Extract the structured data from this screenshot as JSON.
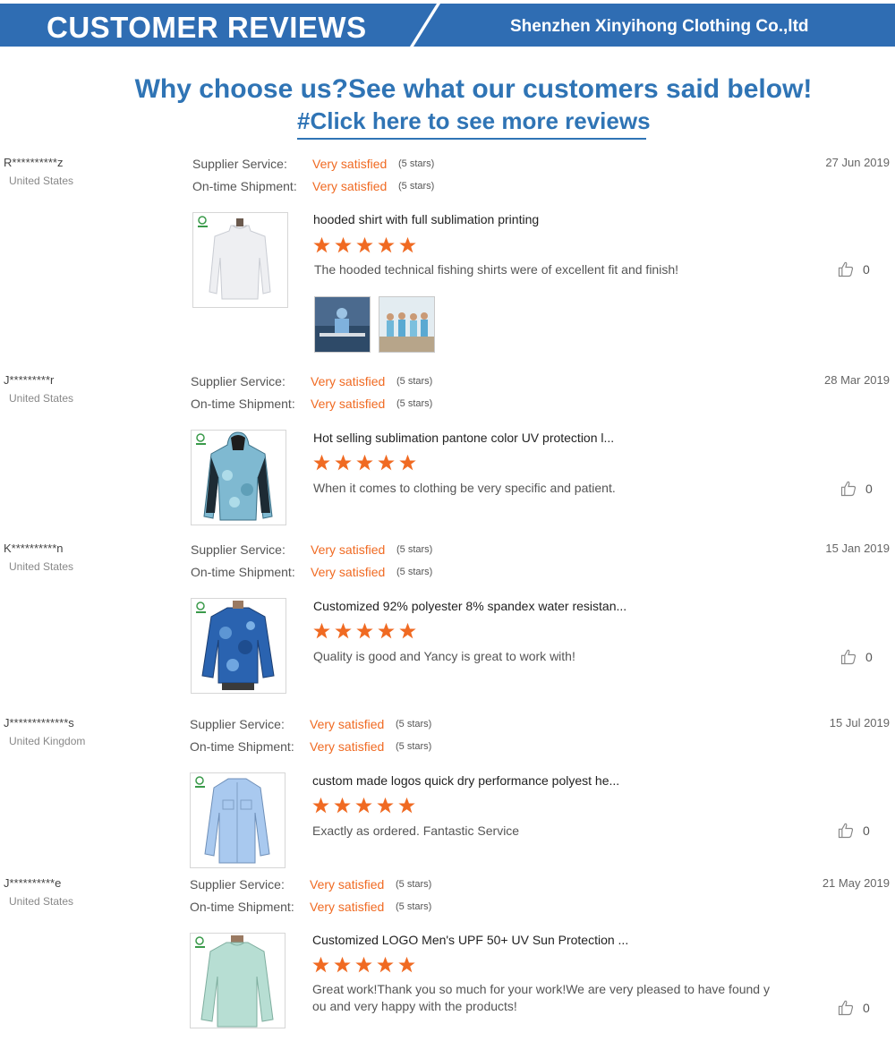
{
  "banner": {
    "title": "CUSTOMER REVIEWS",
    "company": "Shenzhen Xinyihong Clothing Co.,ltd",
    "bg_color": "#2f6db3",
    "accent_color": "#ffffff"
  },
  "intro": {
    "headline": "Why choose us?See what our customers said below!",
    "more_link": "#Click here to see more reviews"
  },
  "labels": {
    "supplier_service": "Supplier Service:",
    "on_time_shipment": "On-time Shipment:"
  },
  "colors": {
    "accent": "#f06a22",
    "headline": "#2f74b5"
  },
  "reviews": [
    {
      "user": "R**********z",
      "country": "United States",
      "date": "27 Jun 2019",
      "supplier_rating": "Very satisfied",
      "supplier_stars": "(5 stars)",
      "shipment_rating": "Very satisfied",
      "shipment_stars": "(5 stars)",
      "product_title": "hooded shirt with full sublimation printing",
      "product_image": "white-long-sleeve-shirt",
      "rating": 5,
      "comment": "The hooded technical fishing shirts were of excellent fit and finish!",
      "likes": "0",
      "photos": [
        "customer-photo-boat",
        "customer-photo-group"
      ]
    },
    {
      "user": "J*********r",
      "country": "United States",
      "date": "28 Mar 2019",
      "supplier_rating": "Very satisfied",
      "supplier_stars": "(5 stars)",
      "shipment_rating": "Very satisfied",
      "shipment_stars": "(5 stars)",
      "product_title": "Hot selling sublimation pantone color UV protection l...",
      "product_image": "camo-hooded-shirt",
      "rating": 5,
      "comment": "When it comes to clothing be very specific and patient.",
      "likes": "0"
    },
    {
      "user": "K**********n",
      "country": "United States",
      "date": "15 Jan 2019",
      "supplier_rating": "Very satisfied",
      "supplier_stars": "(5 stars)",
      "shipment_rating": "Very satisfied",
      "shipment_stars": "(5 stars)",
      "product_title": "Customized 92% polyester 8% spandex water resistan...",
      "product_image": "blue-camo-shirt",
      "rating": 5,
      "comment": "Quality is good and Yancy is great to work with!",
      "likes": "0"
    },
    {
      "user": "J*************s",
      "country": "United Kingdom",
      "date": "15 Jul 2019",
      "supplier_rating": "Very satisfied",
      "supplier_stars": "(5 stars)",
      "shipment_rating": "Very satisfied",
      "shipment_stars": "(5 stars)",
      "product_title": "custom made logos quick dry performance polyest he...",
      "product_image": "light-blue-button-shirt",
      "rating": 5,
      "comment": "Exactly as ordered. Fantastic Service",
      "likes": "0"
    },
    {
      "user": "J**********e",
      "country": "United States",
      "date": "21 May 2019",
      "supplier_rating": "Very satisfied",
      "supplier_stars": "(5 stars)",
      "shipment_rating": "Very satisfied",
      "shipment_stars": "(5 stars)",
      "product_title": "Customized LOGO Men's UPF 50+ UV Sun Protection ...",
      "product_image": "mint-long-sleeve-shirt",
      "rating": 5,
      "comment": "Great work!Thank you so much for your work!We are very pleased to have found y ou and very happy with the products!",
      "likes": "0"
    }
  ]
}
